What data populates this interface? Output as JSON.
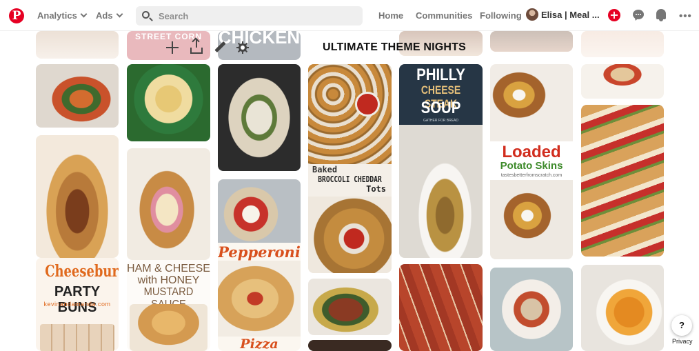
{
  "nav": {
    "analytics_label": "Analytics",
    "ads_label": "Ads",
    "search_placeholder": "Search",
    "home_label": "Home",
    "communities_label": "Communities",
    "following_label": "Following",
    "profile_name": "Elisa | Meal ...",
    "logo_letter": "P",
    "add_symbol": "+",
    "more_symbol": "•••"
  },
  "board": {
    "title": "ULTIMATE THEME NIGHTS",
    "actions": [
      "add",
      "share",
      "edit",
      "settings"
    ]
  },
  "pins": {
    "pin_street_corn": {
      "text": "STREET CORN"
    },
    "pin_chicken_top": {
      "text": "CHICKEN"
    },
    "pin_cheeseburger_buns": {
      "line1": "Cheeseburger",
      "line2": "PARTY BUNS",
      "site": "kevinandamanda.com"
    },
    "pin_ham_cheese": {
      "line1": "HAM & CHEESE",
      "line2": "with HONEY",
      "line3": "MUSTARD SAUCE"
    },
    "pin_pepperoni": {
      "top": "Pepperoni",
      "bottom": "Pizza bombs"
    },
    "pin_broccoli_tots": {
      "line1": "Baked",
      "line2": "BROCCOLI CHEDDAR",
      "line3": "Tots"
    },
    "pin_philly_soup": {
      "line1": "PHILLY",
      "line2": "CHEESE STEAK",
      "line3": "SOUP",
      "sub": "GATHER FOR BREAD"
    },
    "pin_potato_skins": {
      "line1": "Loaded",
      "line2": "Potato Skins",
      "site": "tastesbetterfromscratch.com"
    }
  },
  "footer": {
    "help_label": "?",
    "privacy_label": "Privacy"
  },
  "colors": {
    "brand_red": "#e60023",
    "nav_gray": "#767676",
    "search_bg": "#efefef"
  }
}
